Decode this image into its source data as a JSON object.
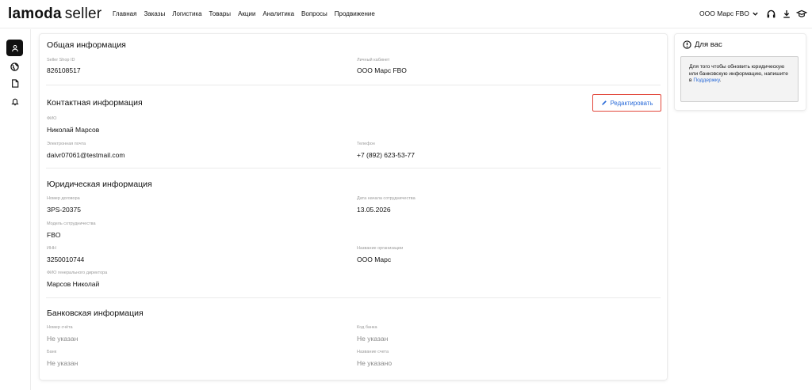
{
  "header": {
    "logo_bold": "lamoda",
    "logo_light": "seller",
    "nav": [
      "Главная",
      "Заказы",
      "Логистика",
      "Товары",
      "Акции",
      "Аналитика",
      "Вопросы",
      "Продвижение"
    ],
    "account": "ООО Марс FBO"
  },
  "general": {
    "title": "Общая информация",
    "shop_id_label": "Seller Shop ID",
    "shop_id": "826108517",
    "cabinet_label": "Личный кабинет",
    "cabinet": "ООО Марс FBO"
  },
  "contact": {
    "title": "Контактная информация",
    "edit_label": "Редактировать",
    "fio_label": "ФИО",
    "fio": "Николай Марсов",
    "email_label": "Электронная почта",
    "email": "daivr07061@testmail.com",
    "phone_label": "Телефон",
    "phone": "+7 (892) 623-53-77"
  },
  "legal": {
    "title": "Юридическая информация",
    "contract_label": "Номер договора",
    "contract": "ЗPS-20375",
    "start_label": "Дата начала сотрудничества",
    "start": "13.05.2026",
    "model_label": "Модель сотрудничества",
    "model": "FBO",
    "inn_label": "ИНН",
    "inn": "3250010744",
    "org_label": "Название организации",
    "org": "ООО Марс",
    "director_label": "ФИО генерального директора",
    "director": "Марсов Николай"
  },
  "bank": {
    "title": "Банковская информация",
    "account_label": "Номер счёта",
    "account": "Не указан",
    "code_label": "Код банка",
    "code": "Не указан",
    "bank_label": "Банк",
    "bank": "Не указан",
    "acc_name_label": "Название счета",
    "acc_name": "Не указано"
  },
  "side": {
    "title": "Для вас",
    "text": "Для того чтобы обновить юридическую или банковскую информацию, напишите в",
    "link": "Поддержку",
    "tail": "."
  },
  "icons": {
    "rail": [
      "user-icon",
      "globe-icon",
      "document-icon",
      "bell-icon"
    ],
    "top": [
      "headset-icon",
      "download-icon",
      "graduation-cap-icon"
    ],
    "edit": "pencil-icon",
    "side": "info-icon"
  },
  "colors": {
    "link": "#2a6bd8",
    "highlight": "#e2463a"
  }
}
